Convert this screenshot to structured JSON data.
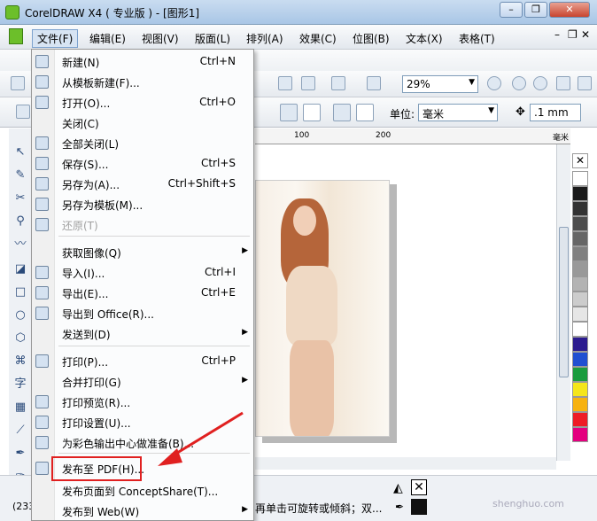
{
  "window": {
    "title": "CorelDRAW X4 ( 专业版 ) - [图形1]",
    "buttons": {
      "minimize": "–",
      "restore": "❐",
      "close": "✕"
    }
  },
  "menubar": {
    "items": [
      "文件(F)",
      "编辑(E)",
      "视图(V)",
      "版面(L)",
      "排列(A)",
      "效果(C)",
      "位图(B)",
      "文本(X)",
      "表格(T)"
    ]
  },
  "doc_controls": {
    "minimize": "–",
    "restore": "❐",
    "close": "✕"
  },
  "toolbar": {
    "zoom": "29%",
    "unit_label": "单位:",
    "unit_value": "毫米",
    "nudge": ".1 mm"
  },
  "ruler": {
    "ticks": [
      "100",
      "200"
    ],
    "unit": "毫米"
  },
  "file_menu": {
    "items": [
      {
        "label": "新建(N)",
        "key": "Ctrl+N"
      },
      {
        "label": "从模板新建(F)...",
        "key": ""
      },
      {
        "label": "打开(O)...",
        "key": "Ctrl+O"
      },
      {
        "label": "关闭(C)",
        "key": ""
      },
      {
        "label": "全部关闭(L)",
        "key": ""
      },
      {
        "label": "保存(S)...",
        "key": "Ctrl+S"
      },
      {
        "label": "另存为(A)...",
        "key": "Ctrl+Shift+S"
      },
      {
        "label": "另存为模板(M)...",
        "key": ""
      },
      {
        "label": "还原(T)",
        "key": ""
      },
      {
        "label": "获取图像(Q)",
        "key": ""
      },
      {
        "label": "导入(I)...",
        "key": "Ctrl+I"
      },
      {
        "label": "导出(E)...",
        "key": "Ctrl+E"
      },
      {
        "label": "导出到 Office(R)...",
        "key": ""
      },
      {
        "label": "发送到(D)",
        "key": ""
      },
      {
        "label": "打印(P)...",
        "key": "Ctrl+P"
      },
      {
        "label": "合并打印(G)",
        "key": ""
      },
      {
        "label": "打印预览(R)...",
        "key": ""
      },
      {
        "label": "打印设置(U)...",
        "key": ""
      },
      {
        "label": "为彩色输出中心做准备(B)...",
        "key": ""
      },
      {
        "label": "发布至 PDF(H)...",
        "key": ""
      },
      {
        "label": "发布页面到 ConceptShare(T)...",
        "key": ""
      },
      {
        "label": "发布到 Web(W)",
        "key": ""
      }
    ]
  },
  "status": {
    "left": "(233",
    "hint": "再单击可旋转或倾斜；双..."
  },
  "watermark": "shenghuo.com",
  "colors": {
    "highlight": "#e02020",
    "palette": [
      "#ffffff",
      "#1a1a1a",
      "#333333",
      "#4d4d4d",
      "#666666",
      "#808080",
      "#999999",
      "#b3b3b3",
      "#cccccc",
      "#e6e6e6",
      "#ffffff",
      "#2b1b8f",
      "#1f4fd1",
      "#1a9c3e",
      "#f5e61a",
      "#f7b20f",
      "#ee1c25",
      "#e4007f"
    ]
  },
  "icons": {
    "app": "coreldraw-icon",
    "arrow": "red-arrow-icon"
  }
}
